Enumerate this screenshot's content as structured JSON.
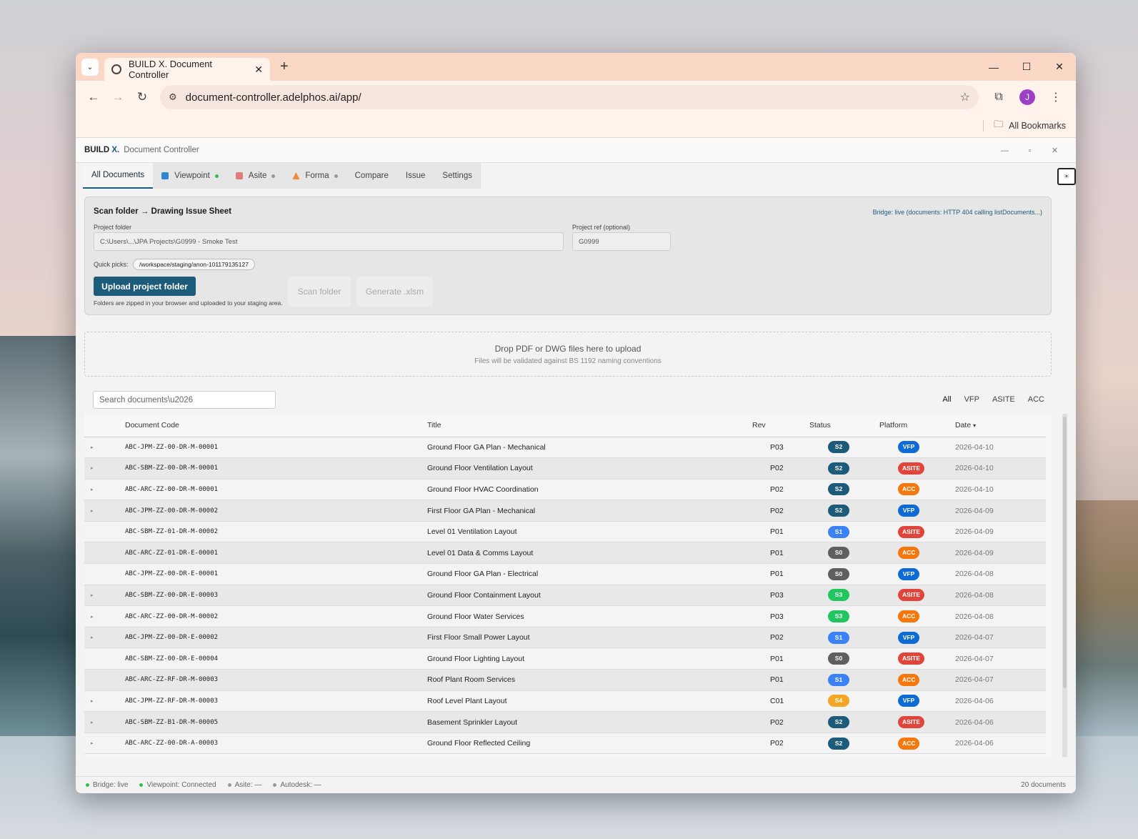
{
  "browser": {
    "tab_title": "BUILD X. Document Controller",
    "url": "document-controller.adelphos.ai/app/",
    "avatar_initial": "J",
    "bookmarks_label": "All Bookmarks"
  },
  "app": {
    "brand": "BUILD",
    "brand_x": "X.",
    "title": "Document Controller",
    "tabs": [
      {
        "label": "All Documents",
        "active": true
      },
      {
        "label": "Viewpoint",
        "dot": "#2fbf4f"
      },
      {
        "label": "Asite",
        "dot": "#999999"
      },
      {
        "label": "Forma",
        "dot": "#999999"
      },
      {
        "label": "Compare"
      },
      {
        "label": "Issue"
      },
      {
        "label": "Settings"
      }
    ]
  },
  "scan": {
    "title": "Scan folder → Drawing Issue Sheet",
    "bridge_status": "Bridge: live (documents: HTTP 404 calling listDocuments...)",
    "project_folder_label": "Project folder",
    "project_folder_value": "C:\\Users\\...\\JPA Projects\\G0999 - Smoke Test",
    "project_ref_label": "Project ref (optional)",
    "project_ref_value": "G0999",
    "quick_picks_label": "Quick picks:",
    "quick_pick": "/workspace/staging/anon-101179135127",
    "upload_button": "Upload project folder",
    "scan_button": "Scan folder",
    "generate_button": "Generate .xlsm",
    "hint": "Folders are zipped in your browser and uploaded to your staging area."
  },
  "dropzone": {
    "title": "Drop PDF or DWG files here to upload",
    "subtitle": "Files will be validated against BS 1192 naming conventions"
  },
  "search": {
    "placeholder": "Search documents\\u2026"
  },
  "filters": [
    "All",
    "VFP",
    "ASITE",
    "ACC"
  ],
  "table": {
    "columns": [
      "Document Code",
      "Title",
      "Rev",
      "Status",
      "Platform",
      "Date"
    ],
    "sort_indicator": "▾",
    "rows": [
      {
        "exp": true,
        "code": "ABC-JPM-ZZ-00-DR-M-00001",
        "title": "Ground Floor GA Plan - Mechanical",
        "rev": "P03",
        "status": "S2",
        "platform": "VFP",
        "date": "2026-04-10"
      },
      {
        "exp": true,
        "code": "ABC-SBM-ZZ-00-DR-M-00001",
        "title": "Ground Floor Ventilation Layout",
        "rev": "P02",
        "status": "S2",
        "platform": "ASITE",
        "date": "2026-04-10"
      },
      {
        "exp": true,
        "code": "ABC-ARC-ZZ-00-DR-M-00001",
        "title": "Ground Floor HVAC Coordination",
        "rev": "P02",
        "status": "S2",
        "platform": "ACC",
        "date": "2026-04-10"
      },
      {
        "exp": true,
        "code": "ABC-JPM-ZZ-00-DR-M-00002",
        "title": "First Floor GA Plan - Mechanical",
        "rev": "P02",
        "status": "S2",
        "platform": "VFP",
        "date": "2026-04-09"
      },
      {
        "exp": false,
        "code": "ABC-SBM-ZZ-01-DR-M-00002",
        "title": "Level 01 Ventilation Layout",
        "rev": "P01",
        "status": "S1",
        "platform": "ASITE",
        "date": "2026-04-09"
      },
      {
        "exp": false,
        "code": "ABC-ARC-ZZ-01-DR-E-00001",
        "title": "Level 01 Data & Comms Layout",
        "rev": "P01",
        "status": "S0",
        "platform": "ACC",
        "date": "2026-04-09"
      },
      {
        "exp": false,
        "code": "ABC-JPM-ZZ-00-DR-E-00001",
        "title": "Ground Floor GA Plan - Electrical",
        "rev": "P01",
        "status": "S0",
        "platform": "VFP",
        "date": "2026-04-08"
      },
      {
        "exp": true,
        "code": "ABC-SBM-ZZ-00-DR-E-00003",
        "title": "Ground Floor Containment Layout",
        "rev": "P03",
        "status": "S3",
        "platform": "ASITE",
        "date": "2026-04-08"
      },
      {
        "exp": true,
        "code": "ABC-ARC-ZZ-00-DR-M-00002",
        "title": "Ground Floor Water Services",
        "rev": "P03",
        "status": "S3",
        "platform": "ACC",
        "date": "2026-04-08"
      },
      {
        "exp": true,
        "code": "ABC-JPM-ZZ-00-DR-E-00002",
        "title": "First Floor Small Power Layout",
        "rev": "P02",
        "status": "S1",
        "platform": "VFP",
        "date": "2026-04-07"
      },
      {
        "exp": false,
        "code": "ABC-SBM-ZZ-00-DR-E-00004",
        "title": "Ground Floor Lighting Layout",
        "rev": "P01",
        "status": "S0",
        "platform": "ASITE",
        "date": "2026-04-07"
      },
      {
        "exp": false,
        "code": "ABC-ARC-ZZ-RF-DR-M-00003",
        "title": "Roof Plant Room Services",
        "rev": "P01",
        "status": "S1",
        "platform": "ACC",
        "date": "2026-04-07"
      },
      {
        "exp": true,
        "code": "ABC-JPM-ZZ-RF-DR-M-00003",
        "title": "Roof Level Plant Layout",
        "rev": "C01",
        "status": "S4",
        "platform": "VFP",
        "date": "2026-04-06"
      },
      {
        "exp": true,
        "code": "ABC-SBM-ZZ-B1-DR-M-00005",
        "title": "Basement Sprinkler Layout",
        "rev": "P02",
        "status": "S2",
        "platform": "ASITE",
        "date": "2026-04-06"
      },
      {
        "exp": true,
        "code": "ABC-ARC-ZZ-00-DR-A-00003",
        "title": "Ground Floor Reflected Ceiling",
        "rev": "P02",
        "status": "S2",
        "platform": "ACC",
        "date": "2026-04-06"
      }
    ]
  },
  "statusbar": {
    "items": [
      {
        "label": "Bridge: live",
        "color": "#2fbf4f"
      },
      {
        "label": "Viewpoint: Connected",
        "color": "#2fbf4f"
      },
      {
        "label": "Asite: —",
        "color": "#999999"
      },
      {
        "label": "Autodesk: —",
        "color": "#999999"
      }
    ],
    "count": "20 documents"
  }
}
